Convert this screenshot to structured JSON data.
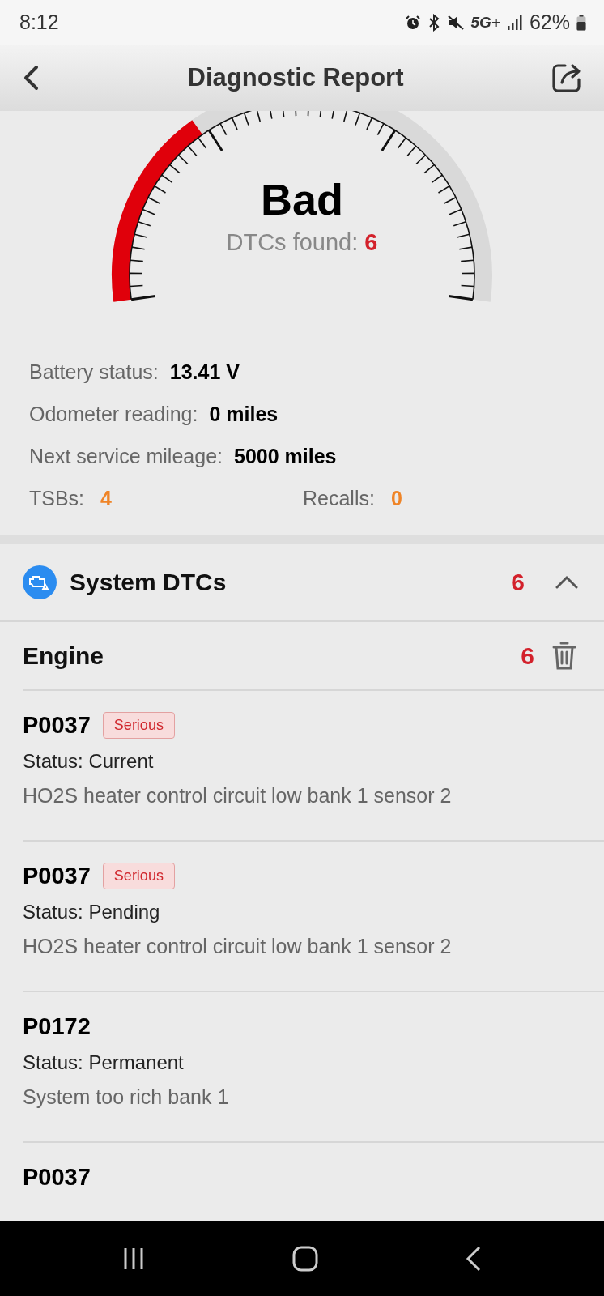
{
  "status_bar": {
    "time": "8:12",
    "network": "5G+",
    "battery": "62%"
  },
  "header": {
    "title": "Diagnostic Report"
  },
  "gauge": {
    "rating": "Bad",
    "dtc_label": "DTCs found:",
    "dtc_count": "6"
  },
  "info": [
    {
      "label": "Battery status:",
      "value": "13.41 V"
    },
    {
      "label": "Odometer reading:",
      "value": "0 miles"
    },
    {
      "label": "Next service mileage:",
      "value": "5000 miles"
    }
  ],
  "counts": [
    {
      "label": "TSBs:",
      "value": "4"
    },
    {
      "label": "Recalls:",
      "value": "0"
    }
  ],
  "section": {
    "title": "System DTCs",
    "count": "6",
    "expanded": true
  },
  "group": {
    "name": "Engine",
    "count": "6"
  },
  "dtcs": [
    {
      "code": "P0037",
      "severity": "Serious",
      "status": "Status: Current",
      "description": "HO2S heater control circuit low bank 1 sensor 2"
    },
    {
      "code": "P0037",
      "severity": "Serious",
      "status": "Status: Pending",
      "description": "HO2S heater control circuit low bank 1 sensor 2"
    },
    {
      "code": "P0172",
      "status": "Status: Permanent",
      "description": "System too rich bank 1"
    },
    {
      "code": "P0037"
    }
  ]
}
